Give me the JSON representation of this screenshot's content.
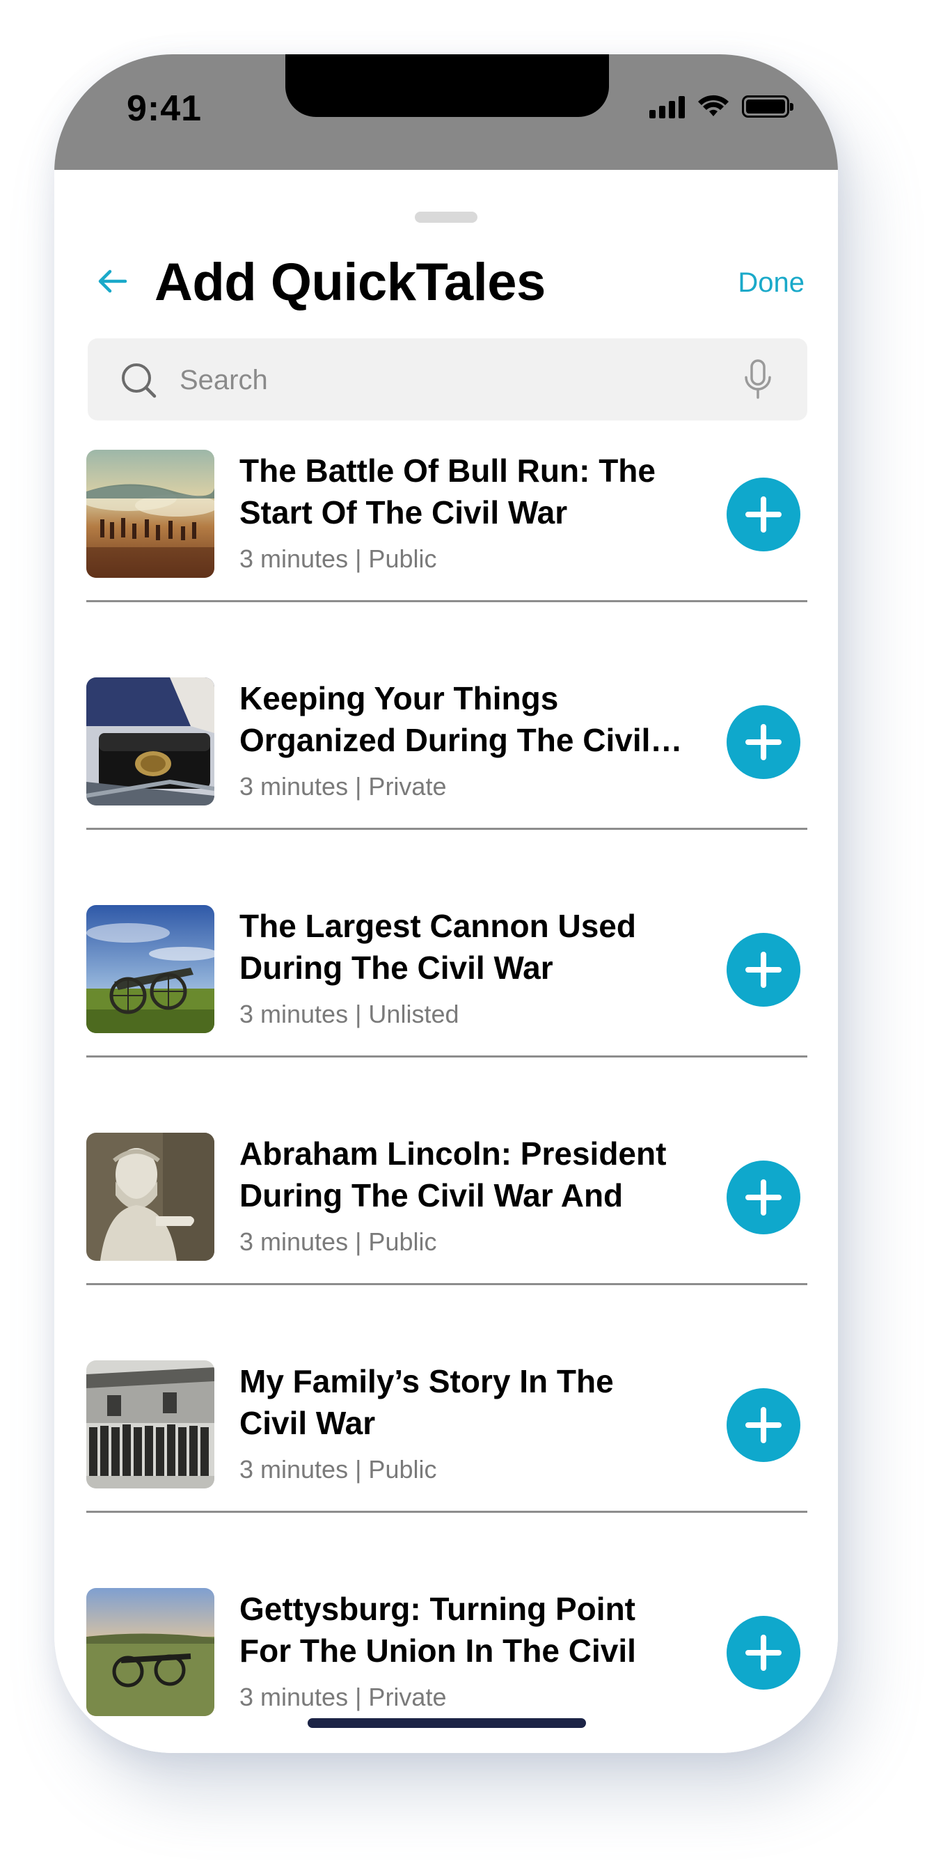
{
  "status_bar": {
    "time": "9:41"
  },
  "header": {
    "title": "Add QuickTales",
    "done_label": "Done",
    "back_icon": "arrow-left-icon"
  },
  "search": {
    "placeholder": "Search",
    "value": ""
  },
  "colors": {
    "accent": "#0fa8cc",
    "status_bar": "#888888",
    "divider": "#8d8d8d"
  },
  "items": [
    {
      "title": "The Battle Of Bull Run: The Start Of The Civil War",
      "meta": "3 minutes | Public",
      "thumbnail": "battle-painting"
    },
    {
      "title": "Keeping Your Things Organized During The Civil…",
      "meta": "3 minutes | Private",
      "thumbnail": "leather-pouch"
    },
    {
      "title": "The Largest Cannon Used During The Civil War",
      "meta": "3 minutes | Unlisted",
      "thumbnail": "cannon-field"
    },
    {
      "title": "Abraham Lincoln: President During The Civil War And Hi…",
      "meta": "3 minutes | Public",
      "thumbnail": "lincoln-statue"
    },
    {
      "title": "My Family’s Story In The Civil War",
      "meta": "3 minutes | Public",
      "thumbnail": "soldiers-photo"
    },
    {
      "title": "Gettysburg: Turning Point For The Union In The Civil War",
      "meta": "3 minutes | Private",
      "thumbnail": "gettysburg-field"
    }
  ]
}
